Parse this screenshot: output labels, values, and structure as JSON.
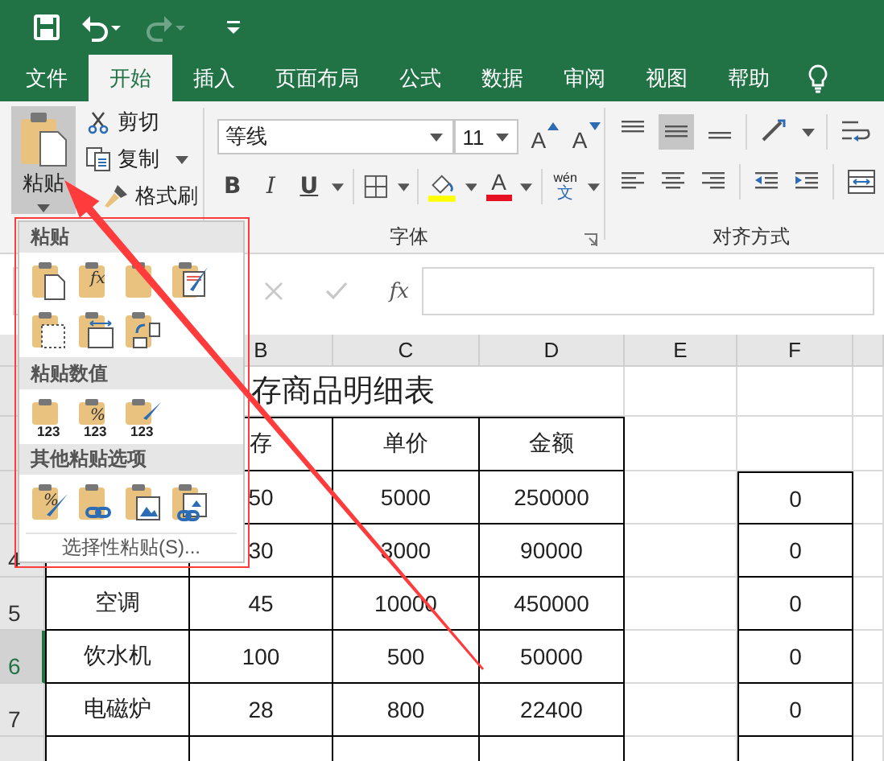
{
  "quick_access": [
    {
      "kind": "save",
      "disabled": false
    },
    {
      "kind": "undo",
      "disabled": false
    },
    {
      "kind": "redo",
      "disabled": true
    },
    {
      "kind": "customize",
      "disabled": false
    }
  ],
  "tabs": [
    {
      "label": "文件",
      "selected": false
    },
    {
      "label": "开始",
      "selected": true
    },
    {
      "label": "插入",
      "selected": false
    },
    {
      "label": "页面布局",
      "selected": false
    },
    {
      "label": "公式",
      "selected": false
    },
    {
      "label": "数据",
      "selected": false
    },
    {
      "label": "审阅",
      "selected": false
    },
    {
      "label": "视图",
      "selected": false
    },
    {
      "label": "帮助",
      "selected": false
    }
  ],
  "ribbon": {
    "clipboard": {
      "paste_label": "粘贴",
      "paste_open": true,
      "items": [
        {
          "kind": "cut",
          "label": "剪切"
        },
        {
          "kind": "copy",
          "label": "复制"
        },
        {
          "kind": "painter",
          "label": "格式刷"
        }
      ]
    },
    "font": {
      "name": "等线",
      "size": "11",
      "size_buttons": [
        {
          "kind": "grow",
          "glyph": "A"
        },
        {
          "kind": "shrink",
          "glyph": "A"
        }
      ],
      "style_buttons": [
        {
          "kind": "bold",
          "glyph": "B"
        },
        {
          "kind": "italic",
          "glyph": "I"
        },
        {
          "kind": "underline",
          "glyph": "U"
        }
      ],
      "font_color_glyph": "A",
      "phonetic": {
        "top": "wén",
        "bottom": "文"
      },
      "label": "字体"
    },
    "alignment": {
      "label": "对齐方式"
    }
  },
  "formula_bar": {
    "function_label": "fx"
  },
  "column_headers": [
    "B",
    "C",
    "D",
    "E",
    "F"
  ],
  "rows": [
    {
      "kind": "title",
      "selected": false,
      "cells": [
        null,
        "存商品明细表",
        null,
        null,
        null,
        null,
        null
      ]
    },
    {
      "kind": "header",
      "selected": false,
      "cells": [
        null,
        "存",
        "单价",
        "金额",
        null,
        null,
        null
      ]
    },
    {
      "kind": "data",
      "selected": false,
      "cells": [
        null,
        "50",
        "5000",
        "250000",
        null,
        "0",
        null
      ]
    },
    {
      "kind": "data",
      "selected": false,
      "number": "4",
      "cells": [
        null,
        "30",
        "3000",
        "90000",
        null,
        "0",
        null
      ]
    },
    {
      "kind": "data",
      "selected": false,
      "number": "5",
      "cells": [
        "空调",
        "45",
        "10000",
        "450000",
        null,
        "0",
        null
      ]
    },
    {
      "kind": "data",
      "selected": true,
      "number": "6",
      "cells": [
        "饮水机",
        "100",
        "500",
        "50000",
        null,
        "0",
        null
      ]
    },
    {
      "kind": "data",
      "selected": false,
      "number": "7",
      "cells": [
        "电磁炉",
        "28",
        "800",
        "22400",
        null,
        "0",
        null
      ]
    },
    {
      "kind": "data",
      "selected": false,
      "cells": [
        null,
        null,
        null,
        null,
        null,
        null,
        null
      ]
    }
  ],
  "paste_menu": {
    "sections": [
      {
        "title": "粘贴",
        "options": [
          {
            "kind": "paste"
          },
          {
            "kind": "formula",
            "glyph": "fx"
          },
          {
            "kind": "formula-number"
          },
          {
            "kind": "source-format"
          },
          {
            "kind": "no-border"
          },
          {
            "kind": "column-width"
          },
          {
            "kind": "transpose"
          }
        ]
      },
      {
        "title": "粘贴数值",
        "options": [
          {
            "kind": "values",
            "subglyph": "123"
          },
          {
            "kind": "values-number",
            "glyph": "%",
            "subglyph": "123"
          },
          {
            "kind": "values-format",
            "subglyph": "123"
          }
        ]
      },
      {
        "title": "其他粘贴选项",
        "options": [
          {
            "kind": "format",
            "glyph": "%"
          },
          {
            "kind": "link"
          },
          {
            "kind": "picture"
          },
          {
            "kind": "linked-picture"
          }
        ]
      }
    ],
    "footer": "选择性粘贴(S)..."
  }
}
